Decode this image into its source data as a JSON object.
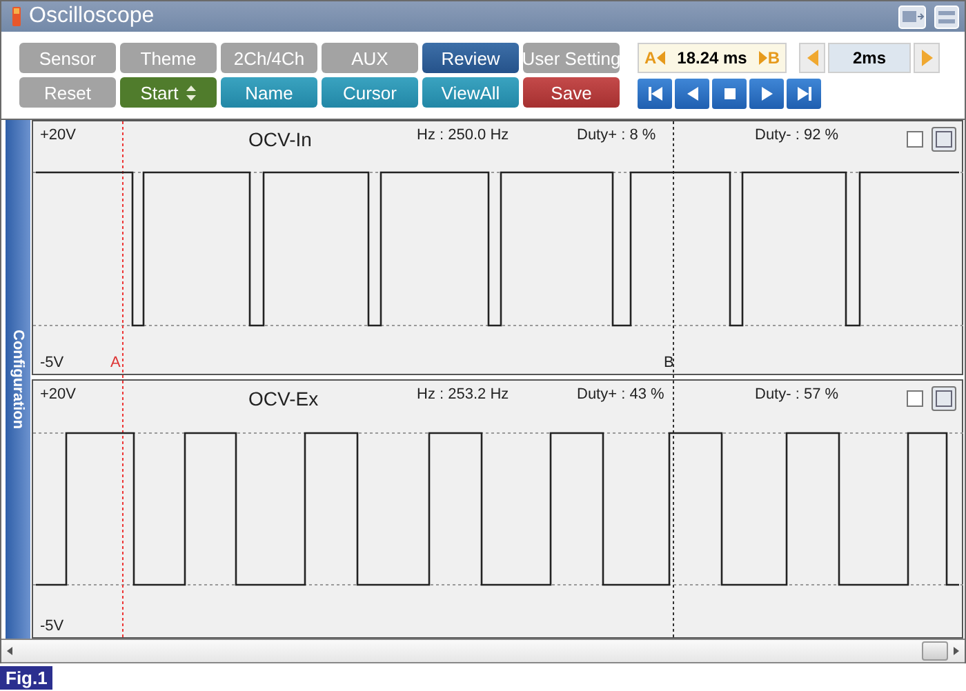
{
  "window": {
    "title": "Oscilloscope"
  },
  "toolbar_buttons": [
    {
      "label": "Sensor",
      "kind": "inactive"
    },
    {
      "label": "Theme",
      "kind": "inactive"
    },
    {
      "label": "2Ch/4Ch",
      "kind": "inactive"
    },
    {
      "label": "AUX",
      "kind": "inactive"
    },
    {
      "label": "Review",
      "kind": "active"
    },
    {
      "label": "User Setting",
      "kind": "inactive"
    },
    {
      "label": "Reset",
      "kind": "inactive"
    },
    {
      "label": "Start",
      "kind": "select"
    },
    {
      "label": "Name",
      "kind": "action"
    },
    {
      "label": "Cursor",
      "kind": "action"
    },
    {
      "label": "ViewAll",
      "kind": "action"
    },
    {
      "label": "Save",
      "kind": "save"
    }
  ],
  "cursor_readout": {
    "left_marker": "A",
    "value": "18.24 ms",
    "right_marker": "B"
  },
  "time_division": {
    "value": "2ms"
  },
  "side_tab": {
    "label": "Configuration"
  },
  "channels": [
    {
      "name": "OCV-In",
      "scale_max": "+20V",
      "scale_min": "-5V",
      "frequency": "Hz : 250.0 Hz",
      "duty_plus": "Duty+ : 8 %",
      "duty_minus": "Duty- : 92 %",
      "checked": false,
      "cursor_labels": [
        "A",
        "B"
      ]
    },
    {
      "name": "OCV-Ex",
      "scale_max": "+20V",
      "scale_min": "-5V",
      "frequency": "Hz : 253.2 Hz",
      "duty_plus": "Duty+ : 43 %",
      "duty_minus": "Duty- : 57 %",
      "checked": false
    }
  ],
  "figure_label": "Fig.1"
}
